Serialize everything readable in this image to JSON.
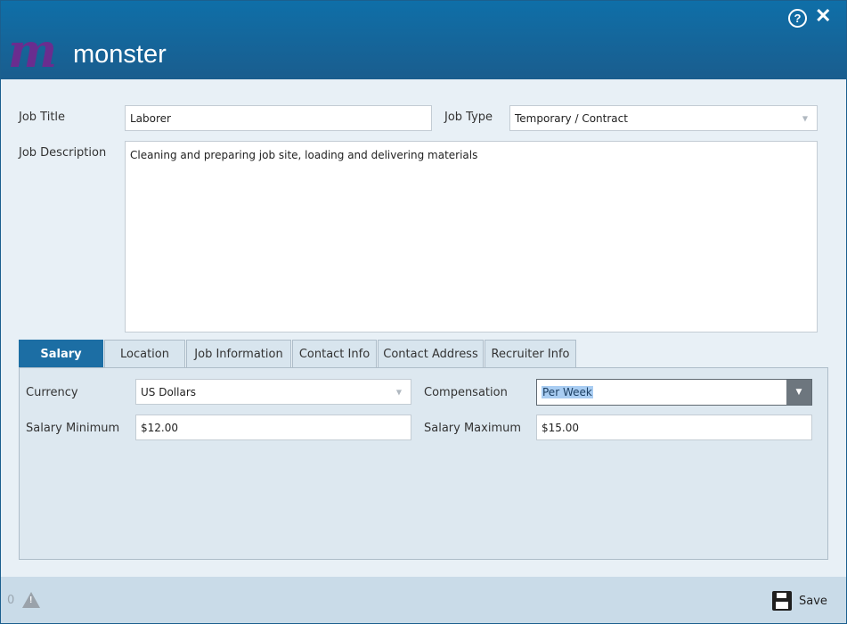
{
  "header": {
    "logo_mark": "m",
    "logo_text": "monster",
    "help_icon": "?",
    "close_icon": "✕"
  },
  "form": {
    "job_title_label": "Job Title",
    "job_title_value": "Laborer",
    "job_type_label": "Job Type",
    "job_type_value": "Temporary / Contract",
    "job_description_label": "Job Description",
    "job_description_value": "Cleaning and preparing job site, loading and delivering materials"
  },
  "tabs": [
    {
      "label": "Salary",
      "active": true
    },
    {
      "label": "Location",
      "active": false
    },
    {
      "label": "Job Information",
      "active": false
    },
    {
      "label": "Contact Info",
      "active": false
    },
    {
      "label": "Contact Address",
      "active": false
    },
    {
      "label": "Recruiter Info",
      "active": false
    }
  ],
  "salary": {
    "currency_label": "Currency",
    "currency_value": "US Dollars",
    "compensation_label": "Compensation",
    "compensation_value": "Per Week",
    "salary_min_label": "Salary Minimum",
    "salary_min_value": "$12.00",
    "salary_max_label": "Salary Maximum",
    "salary_max_value": "$15.00"
  },
  "footer": {
    "warning_count": "0",
    "save_label": "Save"
  },
  "colors": {
    "brand_purple": "#6a2d8f",
    "header_blue": "#0f6fa8",
    "active_tab": "#1c6ea4"
  }
}
